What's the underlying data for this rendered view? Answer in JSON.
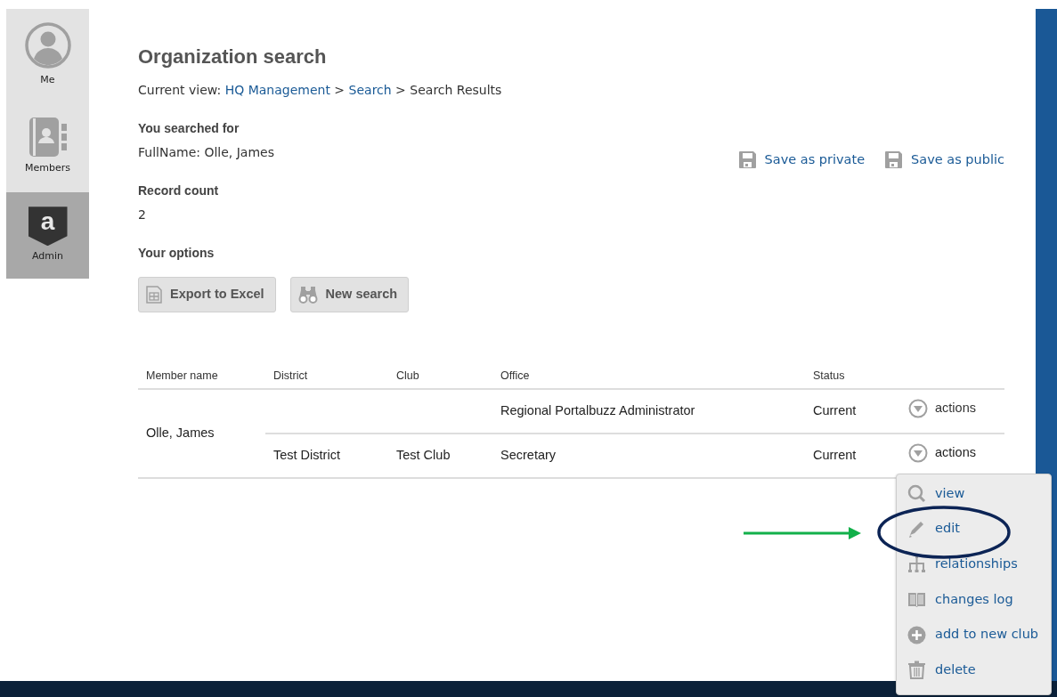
{
  "sidebar": {
    "items": [
      {
        "label": "Me",
        "kind": "person",
        "selected": false
      },
      {
        "label": "Members",
        "kind": "addressbook",
        "selected": false
      },
      {
        "label": "Admin",
        "kind": "badge",
        "glyph": "a",
        "selected": true
      }
    ]
  },
  "page": {
    "title": "Organization search",
    "breadcrumb": {
      "prefix": "Current view:",
      "items": [
        {
          "label": "HQ Management",
          "link": true
        },
        {
          "label": "Search",
          "link": true
        },
        {
          "label": "Search Results",
          "link": false
        }
      ],
      "separator": ">"
    },
    "searched_for": {
      "label": "You searched for",
      "value": "FullName: Olle, James"
    },
    "save_links": [
      {
        "label": "Save as private"
      },
      {
        "label": "Save as public"
      }
    ],
    "record_count": {
      "label": "Record count",
      "value": "2"
    },
    "options": {
      "label": "Your options",
      "buttons": [
        {
          "label": "Export to Excel",
          "kind": "excel"
        },
        {
          "label": "New search",
          "kind": "binoculars"
        }
      ]
    }
  },
  "table": {
    "columns": [
      "Member name",
      "District",
      "Club",
      "Office",
      "Status"
    ],
    "groups": [
      {
        "member_name": "Olle, James",
        "rows": [
          {
            "office": "Regional Portalbuzz Administrator",
            "status": "Current",
            "actions": "actions",
            "expanded": false
          },
          {
            "district": "Test District",
            "club": "Test Club",
            "office": "Secretary",
            "status": "Current",
            "actions": "actions",
            "expanded": true
          }
        ]
      }
    ]
  },
  "actions_menu": {
    "items": [
      {
        "label": "view",
        "kind": "view"
      },
      {
        "label": "edit",
        "kind": "edit"
      },
      {
        "label": "relationships",
        "kind": "relationships"
      },
      {
        "label": "changes log",
        "kind": "log"
      },
      {
        "label": "add to new club",
        "kind": "add"
      },
      {
        "label": "delete",
        "kind": "delete"
      }
    ]
  },
  "annotations": [
    {
      "kind": "arrow",
      "color": "#12b04a"
    },
    {
      "kind": "ellipse",
      "color": "#0c2455"
    }
  ]
}
